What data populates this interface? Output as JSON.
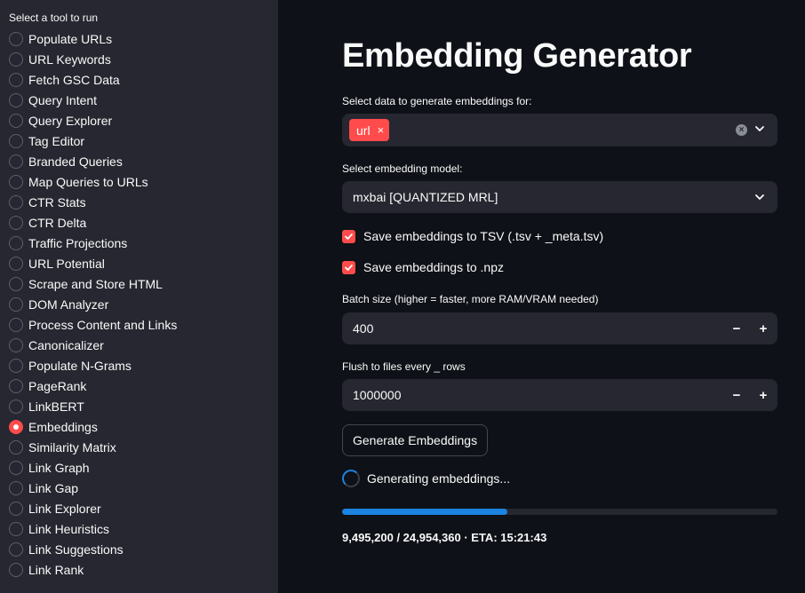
{
  "sidebar": {
    "title": "Select a tool to run",
    "selected_index": 19,
    "items": [
      "Populate URLs",
      "URL Keywords",
      "Fetch GSC Data",
      "Query Intent",
      "Query Explorer",
      "Tag Editor",
      "Branded Queries",
      "Map Queries to URLs",
      "CTR Stats",
      "CTR Delta",
      "Traffic Projections",
      "URL Potential",
      "Scrape and Store HTML",
      "DOM Analyzer",
      "Process Content and Links",
      "Canonicalizer",
      "Populate N-Grams",
      "PageRank",
      "LinkBERT",
      "Embeddings",
      "Similarity Matrix",
      "Link Graph",
      "Link Gap",
      "Link Explorer",
      "Link Heuristics",
      "Link Suggestions",
      "Link Rank"
    ]
  },
  "main": {
    "title": "Embedding Generator",
    "data_select": {
      "label": "Select data to generate embeddings for:",
      "chips": [
        "url"
      ],
      "chip_remove": "×"
    },
    "model_select": {
      "label": "Select embedding model:",
      "value": "mxbai [QUANTIZED MRL]"
    },
    "checkboxes": [
      {
        "label": "Save embeddings to TSV (.tsv + _meta.tsv)",
        "checked": true
      },
      {
        "label": "Save embeddings to .npz",
        "checked": true
      }
    ],
    "batch_size": {
      "label": "Batch size (higher = faster, more RAM/VRAM needed)",
      "value": "400"
    },
    "flush": {
      "label": "Flush to files every _ rows",
      "value": "1000000"
    },
    "stepper": {
      "minus": "−",
      "plus": "+"
    },
    "generate_button": "Generate Embeddings",
    "status_text": "Generating embeddings...",
    "progress": {
      "fraction": 0.38,
      "text": "9,495,200 / 24,954,360 · ETA: 15:21:43"
    }
  },
  "colors": {
    "accent": "#ff4b4b",
    "progress": "#1c83e1",
    "sidebar_bg": "#262730",
    "main_bg": "#0e1117"
  }
}
